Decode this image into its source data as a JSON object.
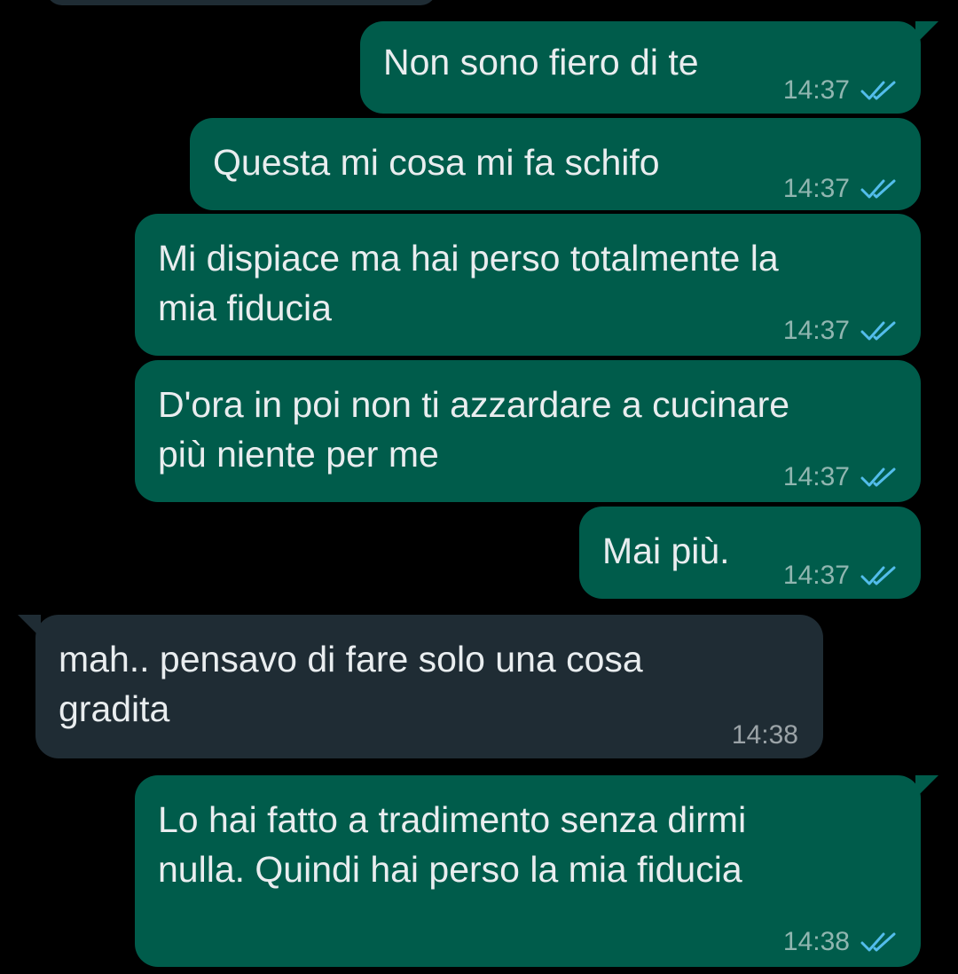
{
  "colors": {
    "background": "#000000",
    "outgoing_bubble": "#005c4b",
    "incoming_bubble": "#1f2c34",
    "message_text": "#e9edef",
    "read_ticks": "#53bdeb"
  },
  "icons": {
    "read_receipt": "double-check-icon"
  },
  "messages": [
    {
      "direction": "outgoing",
      "text": "Non sono fiero di te",
      "time": "14:37",
      "status": "read"
    },
    {
      "direction": "outgoing",
      "text": "Questa mi cosa mi fa schifo",
      "time": "14:37",
      "status": "read"
    },
    {
      "direction": "outgoing",
      "text_lines": [
        "Mi dispiace ma hai perso totalmente la",
        "mia fiducia"
      ],
      "time": "14:37",
      "status": "read"
    },
    {
      "direction": "outgoing",
      "text_lines": [
        "D'ora in poi non ti azzardare a cucinare",
        "più niente per me"
      ],
      "time": "14:37",
      "status": "read"
    },
    {
      "direction": "outgoing",
      "text": "Mai più.",
      "time": "14:37",
      "status": "read"
    },
    {
      "direction": "incoming",
      "text_lines": [
        "mah.. pensavo di fare solo una cosa",
        "gradita"
      ],
      "time": "14:38"
    },
    {
      "direction": "outgoing",
      "text_lines": [
        "Lo hai fatto a tradimento senza dirmi",
        "nulla. Quindi hai perso la mia fiducia"
      ],
      "time": "14:38",
      "status": "read"
    }
  ]
}
